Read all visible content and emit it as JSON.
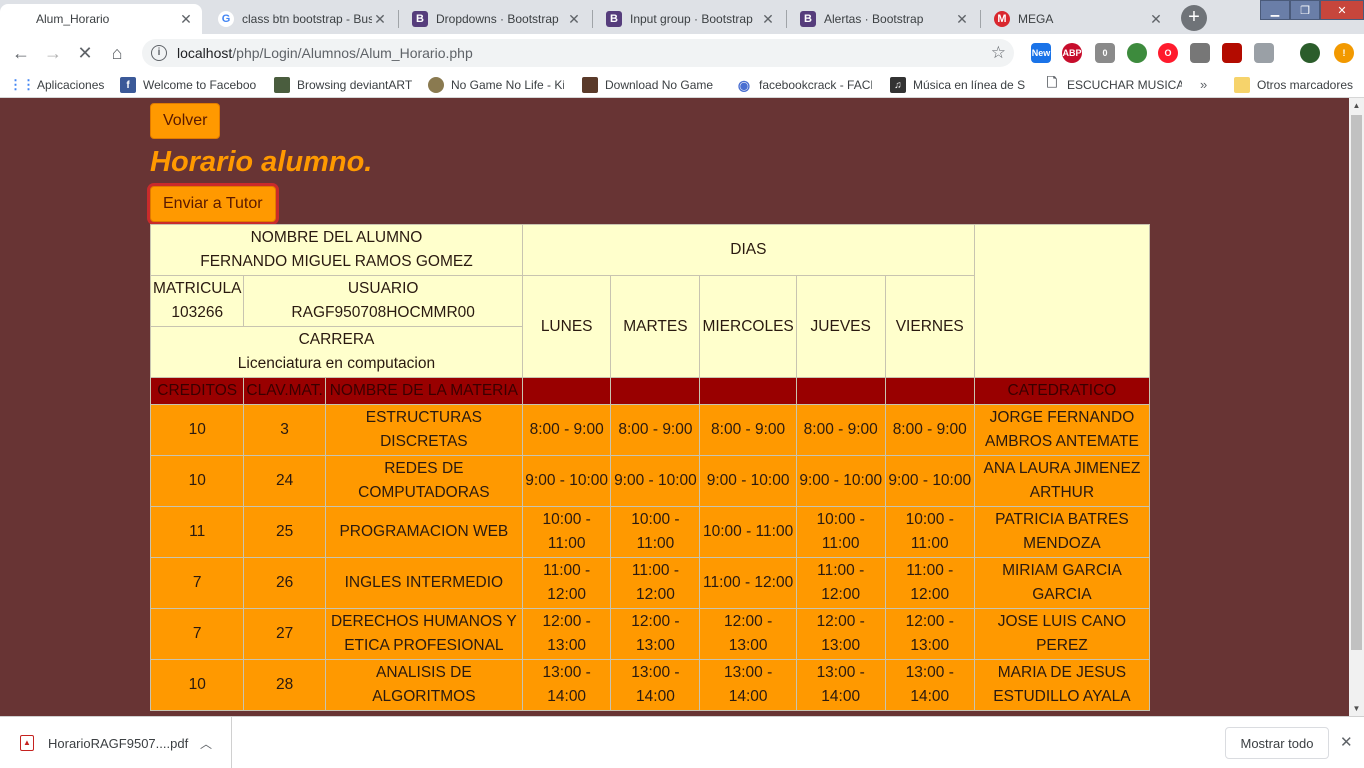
{
  "browser": {
    "tabs": [
      {
        "title": "Alum_Horario",
        "active": true
      },
      {
        "title": "class btn bootstrap - Bus",
        "active": false
      },
      {
        "title": "Dropdowns · Bootstrap",
        "active": false
      },
      {
        "title": "Input group · Bootstrap",
        "active": false
      },
      {
        "title": "Alertas · Bootstrap",
        "active": false
      },
      {
        "title": "MEGA",
        "active": false
      }
    ],
    "url_host": "localhost",
    "url_path": "/php/Login/Alumnos/Alum_Horario.php",
    "bookmarks": [
      "Aplicaciones",
      "Welcome to Faceboo",
      "Browsing deviantART",
      "No Game No Life - Ki",
      "Download No Game",
      "facebookcrack - FACE",
      "Música en línea de SH",
      "ESCUCHAR MUSICA D",
      "Otros marcadores"
    ],
    "more_bookmarks": "»"
  },
  "page": {
    "volver_label": "Volver",
    "title": "Horario alumno.",
    "enviar_label": "Enviar a Tutor",
    "header": {
      "nombre_label": "NOMBRE DEL ALUMNO",
      "nombre_value": "FERNANDO MIGUEL RAMOS GOMEZ",
      "dias_label": "DIAS",
      "matricula_label": "MATRICULA",
      "matricula_value": "103266",
      "usuario_label": "USUARIO",
      "usuario_value": "RAGF950708HOCMMR00",
      "carrera_label": "CARRERA",
      "carrera_value": "Licenciatura en computacion",
      "days": [
        "LUNES",
        "MARTES",
        "MIERCOLES",
        "JUEVES",
        "VIERNES"
      ]
    },
    "columns": {
      "creditos": "CREDITOS",
      "clave": "CLAV.MAT.",
      "materia": "NOMBRE DE LA MATERIA",
      "catedratico": "CATEDRATICO"
    },
    "rows": [
      {
        "creditos": "10",
        "clave": "3",
        "materia": "ESTRUCTURAS DISCRETAS",
        "hora": "8:00 - 9:00",
        "catedratico": "JORGE FERNANDO AMBROS ANTEMATE"
      },
      {
        "creditos": "10",
        "clave": "24",
        "materia": "REDES DE COMPUTADORAS",
        "hora": "9:00 - 10:00",
        "catedratico": "ANA LAURA JIMENEZ ARTHUR"
      },
      {
        "creditos": "11",
        "clave": "25",
        "materia": "PROGRAMACION WEB",
        "hora": "10:00 - 11:00",
        "catedratico": "PATRICIA BATRES MENDOZA"
      },
      {
        "creditos": "7",
        "clave": "26",
        "materia": "INGLES INTERMEDIO",
        "hora": "11:00 - 12:00",
        "catedratico": "MIRIAM GARCIA GARCIA"
      },
      {
        "creditos": "7",
        "clave": "27",
        "materia": "DERECHOS HUMANOS Y ETICA PROFESIONAL",
        "hora": "12:00 - 13:00",
        "catedratico": "JOSE LUIS CANO PEREZ"
      },
      {
        "creditos": "10",
        "clave": "28",
        "materia": "ANALISIS DE ALGORITMOS",
        "hora": "13:00 - 14:00",
        "catedratico": "MARIA DE JESUS ESTUDILLO AYALA"
      }
    ]
  },
  "downloads": {
    "file_name": "HorarioRAGF9507....pdf",
    "show_all": "Mostrar todo"
  },
  "colors": {
    "page_bg": "#683434",
    "accent_orange": "#ff9900",
    "header_cream": "#ffffcc",
    "column_header_red": "#990000"
  }
}
